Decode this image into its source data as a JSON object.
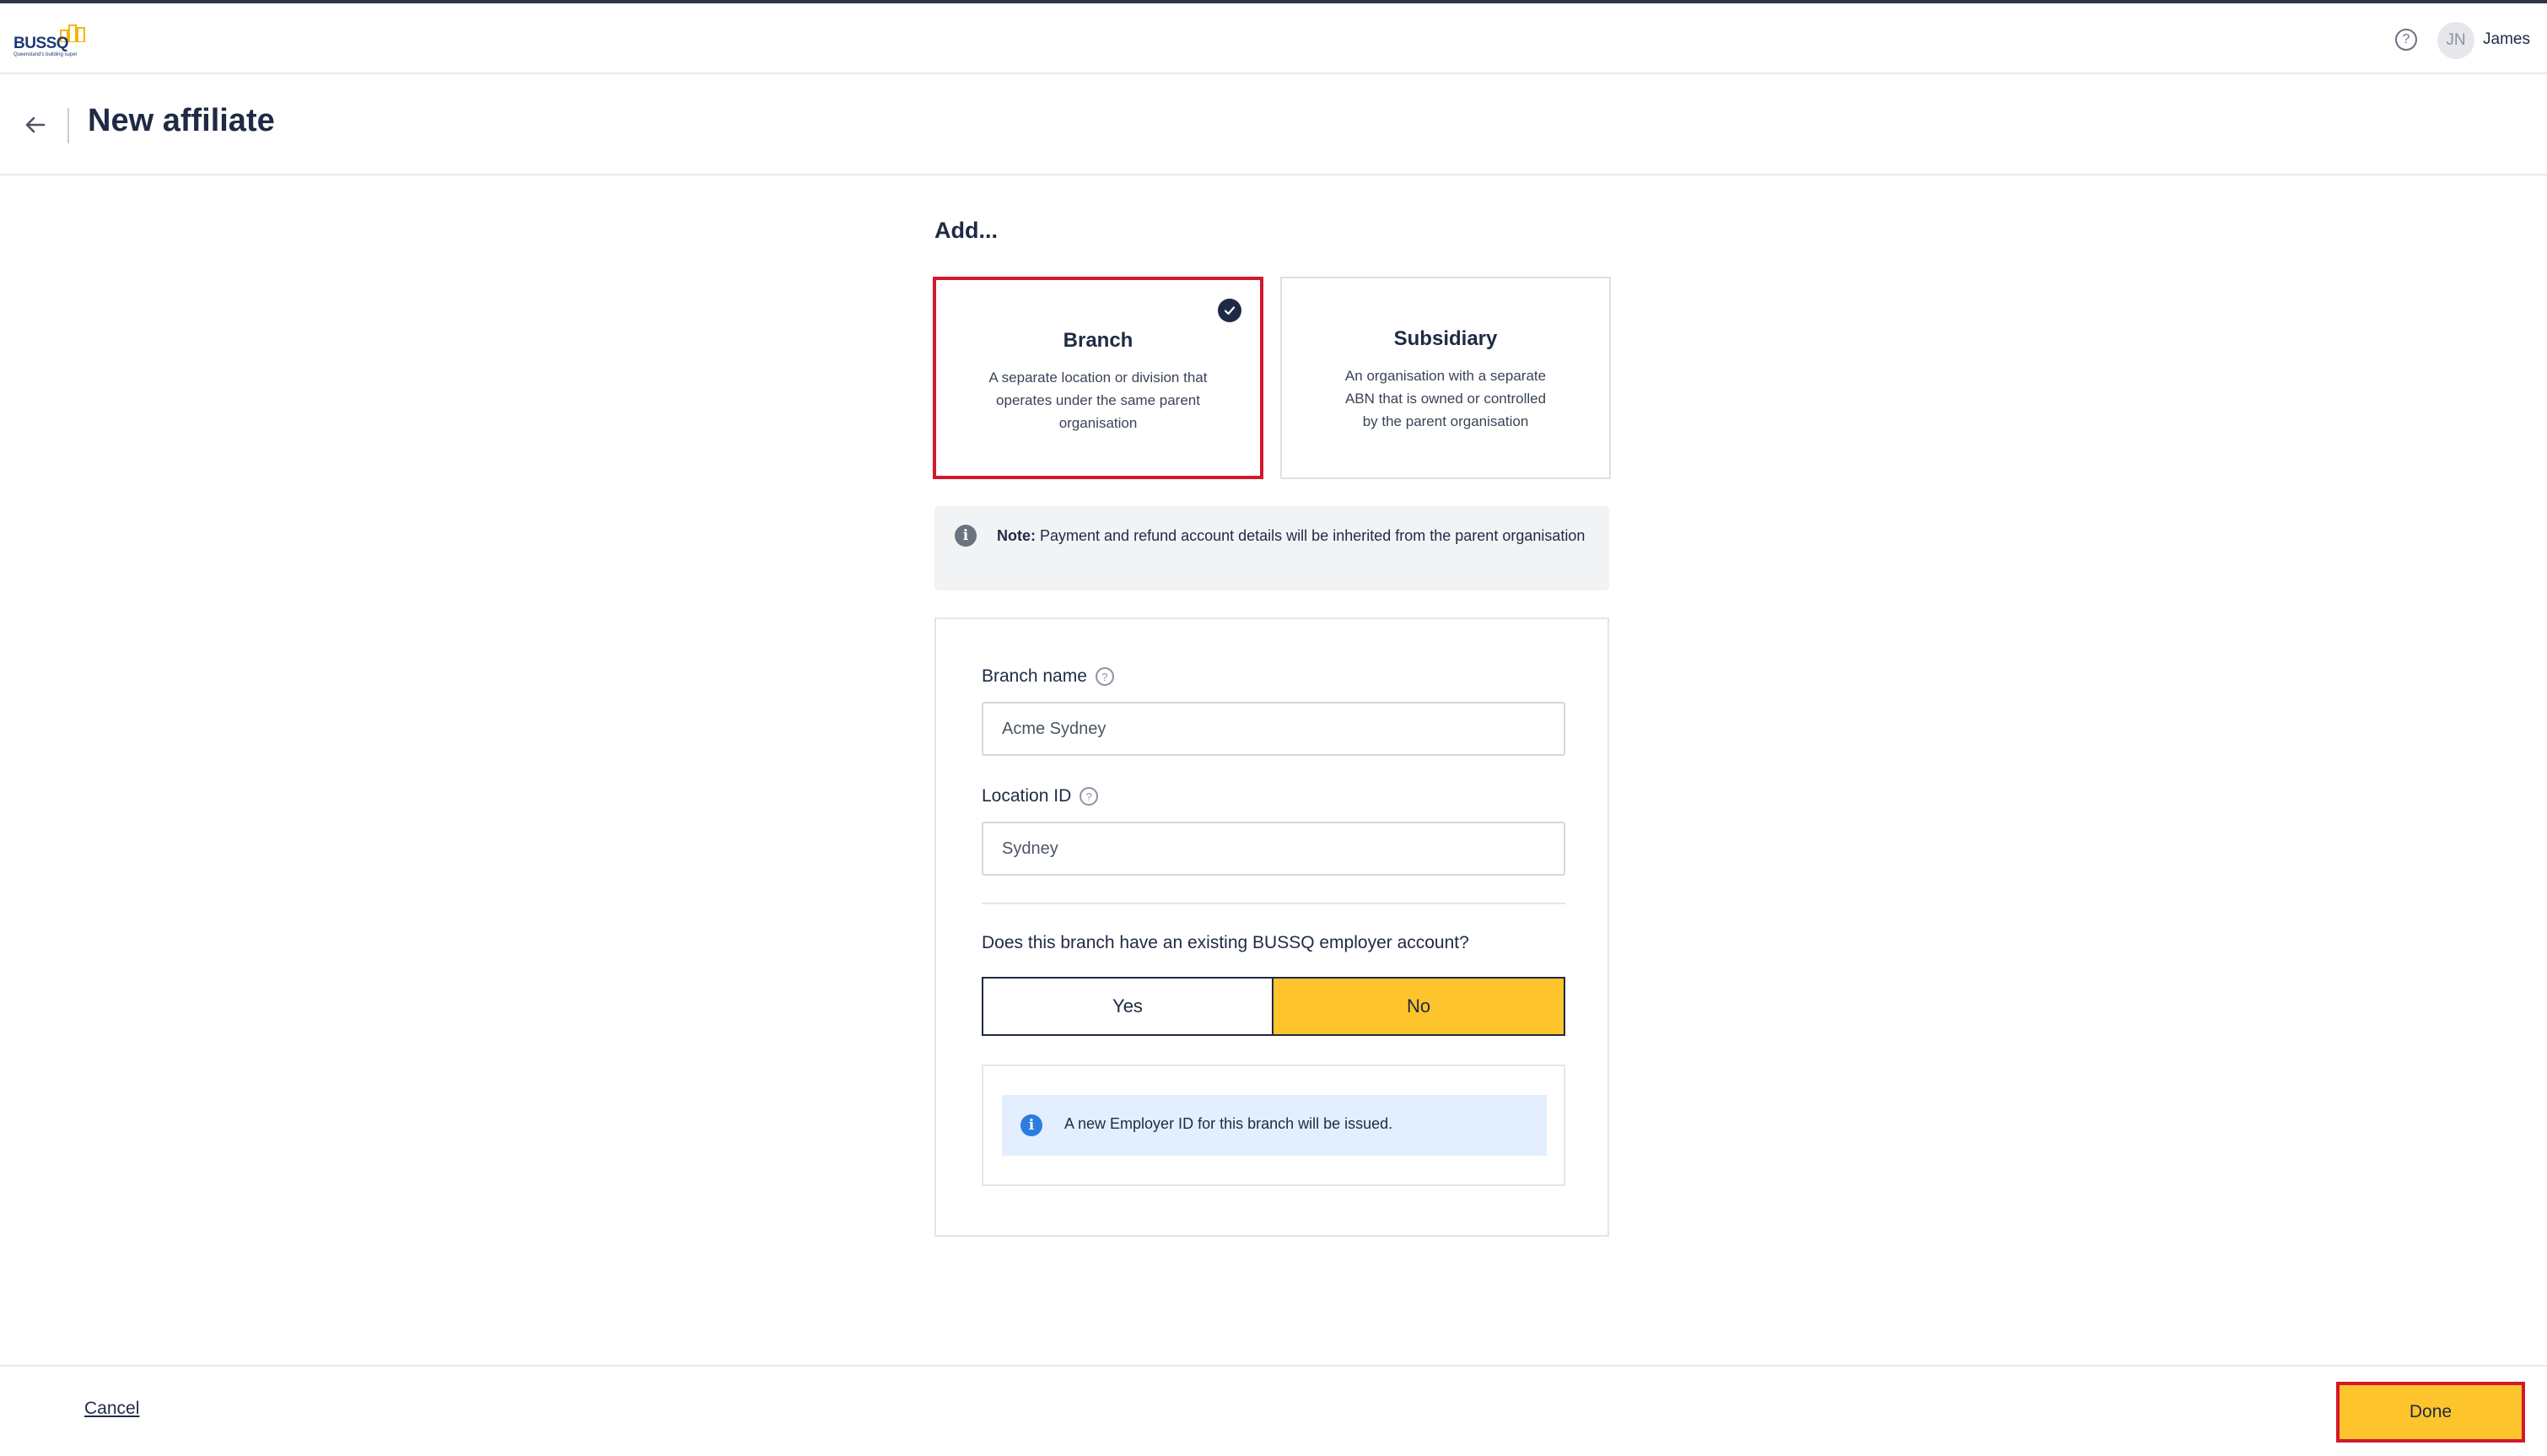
{
  "app": {
    "logo_text": "BUSSQ",
    "logo_tagline": "Queensland's building super",
    "user_initials": "JN",
    "user_name": "James",
    "help_glyph": "?"
  },
  "page": {
    "title": "New affiliate",
    "back_glyph": "←"
  },
  "add_section": {
    "heading": "Add...",
    "options": [
      {
        "title": "Branch",
        "description": "A separate location or division that operates under the same parent organisation",
        "selected": true
      },
      {
        "title": "Subsidiary",
        "description": "An organisation with a separate ABN that is owned or controlled by the parent organisation",
        "selected": false
      }
    ]
  },
  "note": {
    "label": "Note:",
    "text": " Payment and refund account details will be inherited from the parent organisation"
  },
  "form": {
    "branch_name_label": "Branch name",
    "branch_name_value": "Acme Sydney",
    "location_id_label": "Location ID",
    "location_id_value": "Sydney",
    "question": "Does this branch have an existing BUSSQ employer account?",
    "yes_label": "Yes",
    "no_label": "No",
    "selected_answer": "No",
    "info_text": "A new Employer ID for this branch will be issued."
  },
  "footer": {
    "cancel_label": "Cancel",
    "done_label": "Done"
  },
  "colors": {
    "accent_yellow": "#fdc42b",
    "highlight_red": "#d4182d",
    "navy": "#1f2a44",
    "info_blue": "#2d7de0",
    "info_bg": "#e3efff"
  },
  "icons": {
    "back": "arrow-left-icon",
    "help": "question-circle-icon",
    "check": "check-circle-icon",
    "note": "info-icon",
    "field_help": "question-circle-icon",
    "info": "info-icon"
  }
}
